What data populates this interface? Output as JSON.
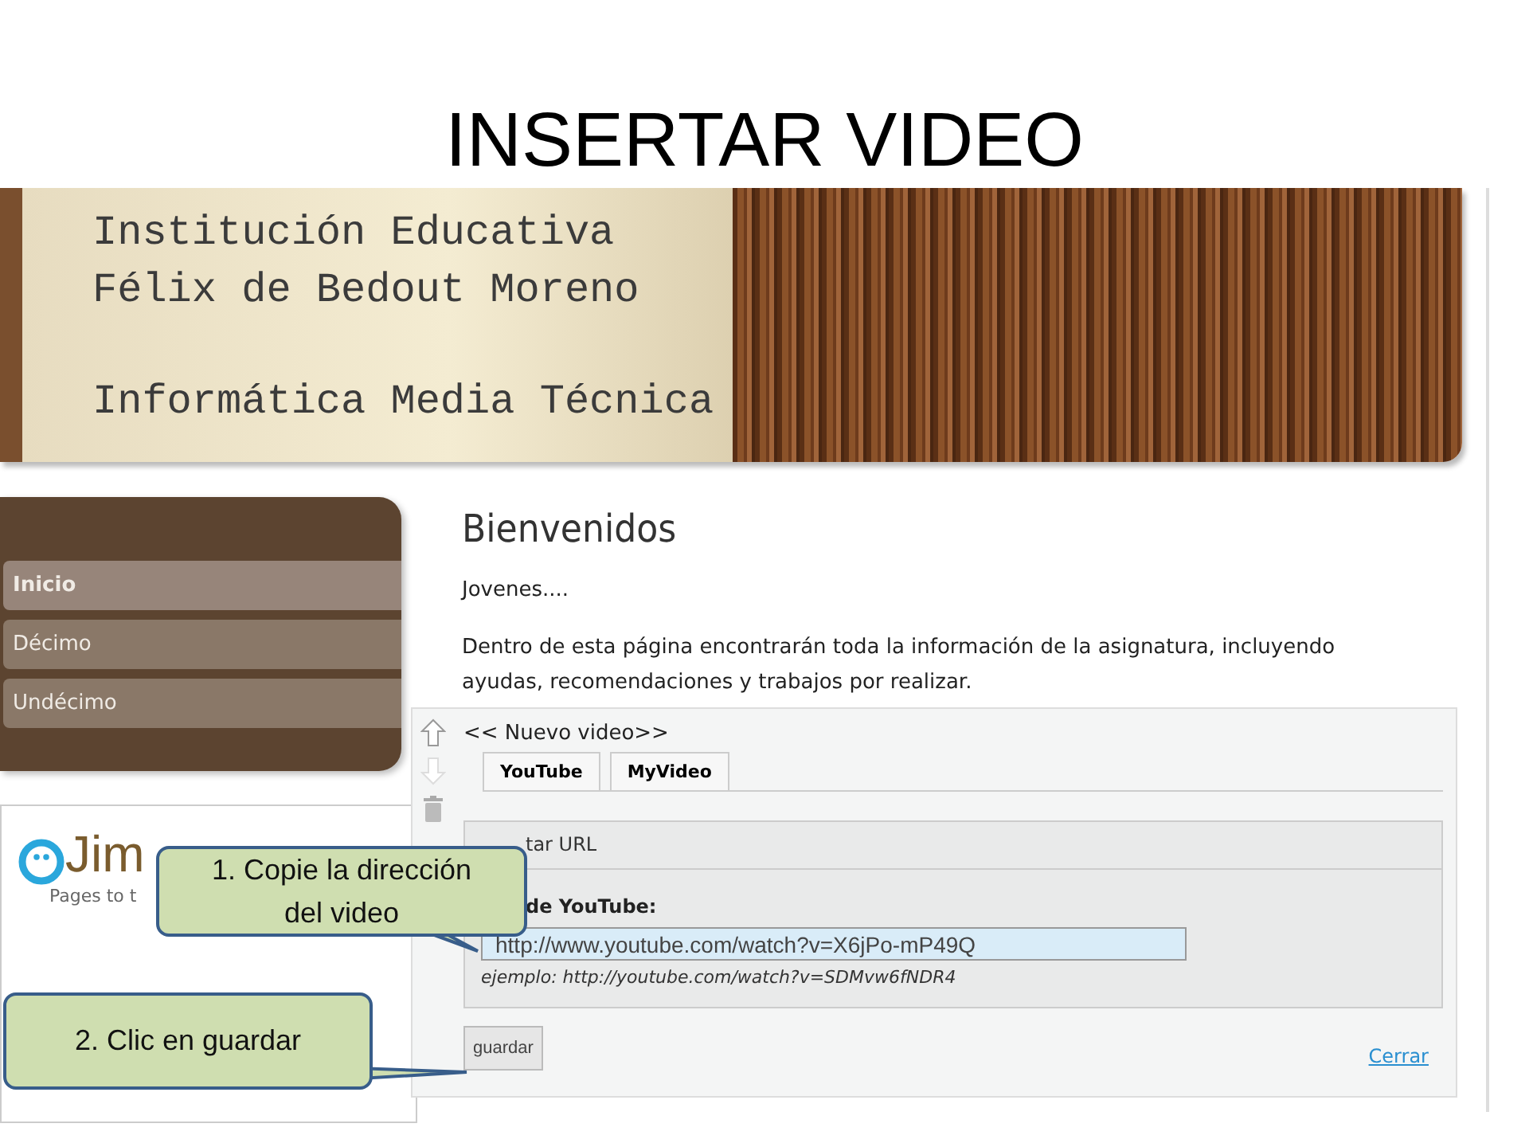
{
  "title": "INSERTAR VIDEO",
  "header": {
    "lines": [
      "Institución Educativa",
      "Félix de Bedout Moreno",
      "Informática Media Técnica"
    ]
  },
  "nav": [
    {
      "label": "Inicio",
      "selected": true
    },
    {
      "label": "Décimo",
      "selected": false
    },
    {
      "label": "Undécimo",
      "selected": false
    }
  ],
  "logo": {
    "word": "Jim",
    "tagline": "Pages to t"
  },
  "main": {
    "heading": "Bienvenidos",
    "paragraphs": [
      "Jovenes....",
      "Dentro de esta página encontrarán toda la información de la asignatura, incluyendo ayudas, recomendaciones y trabajos por realizar."
    ]
  },
  "video_editor": {
    "title": "<< Nuevo video>>",
    "tabs": [
      {
        "label": "YouTube"
      },
      {
        "label": "MyVideo"
      }
    ],
    "section_label": "tar URL",
    "field_label": "de YouTube:",
    "url_value": "http://www.youtube.com/watch?v=X6jPo-mP49Q",
    "example": "ejemplo: http://youtube.com/watch?v=SDMvw6fNDR4",
    "save_button": "guardar",
    "close_link": "Cerrar"
  },
  "callouts": [
    {
      "text": "1. Copie la dirección del video"
    },
    {
      "text": "2. Clic en guardar"
    }
  ]
}
